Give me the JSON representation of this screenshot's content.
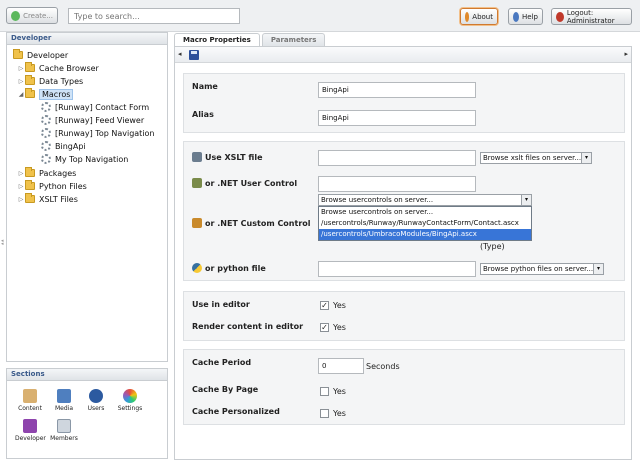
{
  "topbar": {
    "create_label": "Create...",
    "search_placeholder": "Type to search...",
    "about_label": "About",
    "help_label": "Help",
    "logout_label": "Logout: Administrator"
  },
  "tree": {
    "header": "Developer",
    "root": "Developer",
    "items": [
      "Cache Browser",
      "Data Types",
      "Macros",
      "Packages",
      "Python Files",
      "XSLT Files"
    ],
    "macros": [
      "[Runway] Contact Form",
      "[Runway] Feed Viewer",
      "[Runway] Top Navigation",
      "BingApi",
      "My Top Navigation"
    ]
  },
  "sections": {
    "header": "Sections",
    "items": [
      "Content",
      "Media",
      "Users",
      "Settings",
      "Developer",
      "Members"
    ]
  },
  "tabs": [
    "Macro Properties",
    "Parameters"
  ],
  "form": {
    "name_label": "Name",
    "name_value": "BingApi",
    "alias_label": "Alias",
    "alias_value": "BingApi",
    "xslt_label": "Use XSLT file",
    "xslt_browse": "Browse xslt files on server...",
    "usercontrol_label": "or .NET User Control",
    "usercontrol_browse": "Browse usercontrols on server...",
    "usercontrol_options": [
      "Browse usercontrols on server...",
      "/usercontrols/Runway/RunwayContactForm/Contact.ascx",
      "/usercontrols/UmbracoModules/BingApi.ascx"
    ],
    "custom_label": "or .NET Custom Control",
    "type_label": "(Type)",
    "python_label": "or python file",
    "python_browse": "Browse python files on server...",
    "use_in_editor_label": "Use in editor",
    "use_in_editor_yes": "Yes",
    "render_label": "Render content in editor",
    "render_yes": "Yes",
    "cache_period_label": "Cache Period",
    "cache_period_value": "0",
    "seconds_label": "Seconds",
    "cache_by_page_label": "Cache By Page",
    "cache_by_page_yes": "Yes",
    "cache_personalized_label": "Cache Personalized",
    "cache_personalized_yes": "Yes"
  },
  "colors": {
    "accent": "#3875d7",
    "folder": "#f0c24b",
    "header_text": "#3a5a8a"
  },
  "icons": [
    "plus-icon",
    "info-icon",
    "help-icon",
    "logout-icon",
    "folder-icon",
    "gear-icon",
    "save-icon"
  ]
}
